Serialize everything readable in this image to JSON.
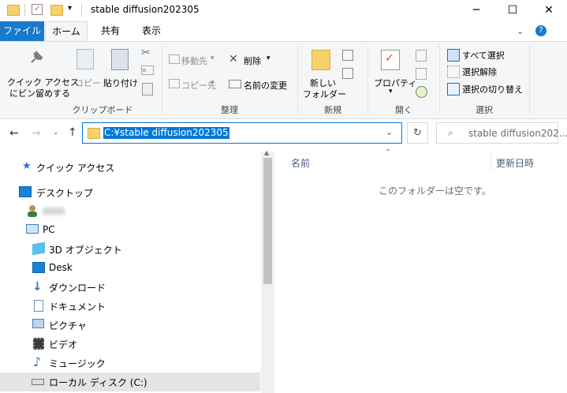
{
  "window": {
    "title": "stable diffusion202305",
    "minimize": "─",
    "maximize": "☐",
    "close": "✕"
  },
  "ribbon_tabs": {
    "file": "ファイル",
    "home": "ホーム",
    "share": "共有",
    "view": "表示"
  },
  "ribbon": {
    "pin": "クイック アクセス\nにピン留めする",
    "pin_line1": "クイック アクセス",
    "pin_line2": "にピン留めする",
    "copy": "コピー",
    "paste": "貼り付け",
    "clipboard_group": "クリップボード",
    "move_to": "移動先",
    "copy_to": "コピー先",
    "delete": "削除",
    "rename": "名前の変更",
    "organize_group": "整理",
    "new_folder_line1": "新しい",
    "new_folder_line2": "フォルダー",
    "new_group": "新規",
    "properties": "プロパティ",
    "open_group": "開く",
    "select_all": "すべて選択",
    "select_none": "選択解除",
    "invert_selection": "選択の切り替え",
    "select_group": "選択"
  },
  "address": {
    "path": "C:¥stable diffusion202305"
  },
  "search": {
    "placeholder": "stable diffusion202..."
  },
  "nav": {
    "quick_access": "クイック アクセス",
    "desktop": "デスクトップ",
    "pc": "PC",
    "objects3d": "3D オブジェクト",
    "desk": "Desk",
    "downloads": "ダウンロード",
    "documents": "ドキュメント",
    "pictures": "ピクチャ",
    "videos": "ビデオ",
    "music": "ミュージック",
    "local_disk": "ローカル ディスク (C:)"
  },
  "content": {
    "col_name": "名前",
    "col_date": "更新日時",
    "empty_message": "このフォルダーは空です。"
  },
  "colors": {
    "accent": "#0078d7",
    "file_tab": "#1979ca",
    "folder": "#f7d26b"
  }
}
